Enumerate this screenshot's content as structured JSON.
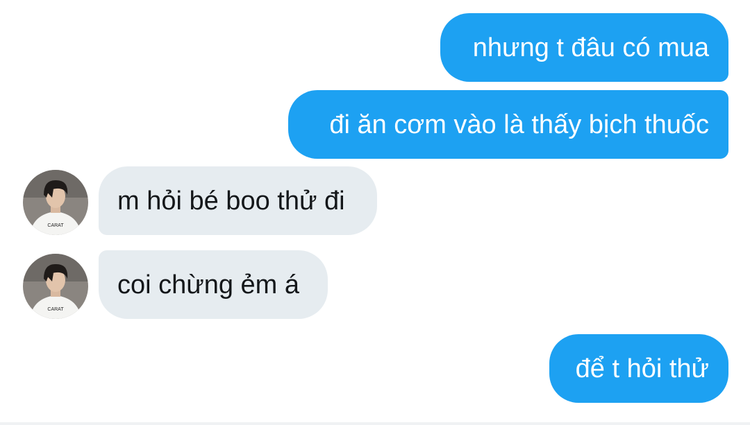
{
  "conversation": {
    "messages": [
      {
        "sender": "me",
        "text": "nhưng t đâu có mua"
      },
      {
        "sender": "me",
        "text": "đi ăn cơm vào là thấy bịch thuốc"
      },
      {
        "sender": "other",
        "text": "m hỏi bé boo thử đi"
      },
      {
        "sender": "other",
        "text": "coi chừng ẻm á"
      },
      {
        "sender": "me",
        "text": "để t hỏi thử"
      }
    ],
    "avatar": {
      "shirt_text": "CARAT",
      "icon": "user-avatar-photo"
    }
  },
  "colors": {
    "sent_bubble": "#1da1f2",
    "sent_text": "#ffffff",
    "received_bubble": "#e6ecf0",
    "received_text": "#14171a",
    "background": "#ffffff"
  }
}
